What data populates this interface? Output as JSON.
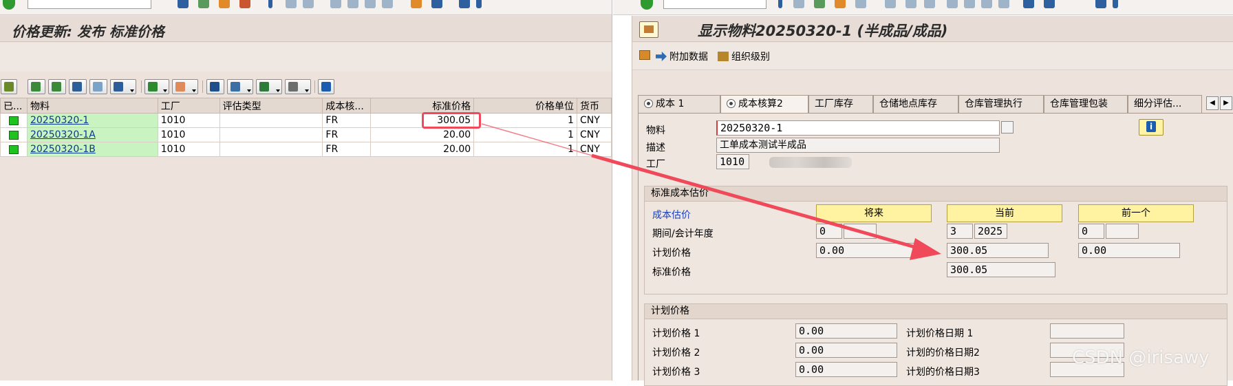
{
  "left": {
    "title": "价格更新: 发布 标准价格",
    "columns": [
      "已...",
      "物料",
      "工厂",
      "评估类型",
      "成本核...",
      "标准价格",
      "价格单位",
      "货币"
    ],
    "rows": [
      {
        "material": "20250320-1",
        "plant": "1010",
        "valtype": "",
        "costing": "FR",
        "std_price": "300.05",
        "unit": "1",
        "currency": "CNY"
      },
      {
        "material": "20250320-1A",
        "plant": "1010",
        "valtype": "",
        "costing": "FR",
        "std_price": "20.00",
        "unit": "1",
        "currency": "CNY"
      },
      {
        "material": "20250320-1B",
        "plant": "1010",
        "valtype": "",
        "costing": "FR",
        "std_price": "20.00",
        "unit": "1",
        "currency": "CNY"
      }
    ]
  },
  "right": {
    "title": "显示物料20250320-1 (半成品/成品)",
    "toolbar": {
      "additional_data": "附加数据",
      "org_levels": "组织级别"
    },
    "tabs": [
      "成本 1",
      "成本核算2",
      "工厂库存",
      "仓储地点库存",
      "仓库管理执行",
      "仓库管理包装",
      "细分评估..."
    ],
    "header": {
      "material_label": "物料",
      "material_value": "20250320-1",
      "desc_label": "描述",
      "desc_value": "工单成本测试半成品",
      "plant_label": "工厂",
      "plant_value": "1010"
    },
    "std_cost": {
      "group_title": "标准成本估价",
      "cost_est_label": "成本估价",
      "future_btn": "将来",
      "current_btn": "当前",
      "previous_btn": "前一个",
      "period_label": "期间/会计年度",
      "future_period": "0",
      "future_year": "",
      "current_period": "3",
      "current_year": "2025",
      "previous_period": "0",
      "previous_year": "",
      "plan_price_label": "计划价格",
      "future_plan": "0.00",
      "current_plan": "300.05",
      "previous_plan": "0.00",
      "std_price_label": "标准价格",
      "current_std": "300.05"
    },
    "plan_price": {
      "group_title": "计划价格",
      "p1_label": "计划价格 1",
      "p1_value": "0.00",
      "d1_label": "计划价格日期 1",
      "p2_label": "计划价格 2",
      "p2_value": "0.00",
      "d2_label": "计划的价格日期2",
      "p3_label": "计划价格 3",
      "p3_value": "0.00",
      "d3_label": "计划的价格日期3"
    }
  },
  "watermark": "CSDN @irisawy",
  "colors": {
    "highlight": "#f04a5a",
    "material_cell": "#c9f3c0",
    "status_led": "#1fc31f",
    "button_yellow": "#fff2a1"
  }
}
